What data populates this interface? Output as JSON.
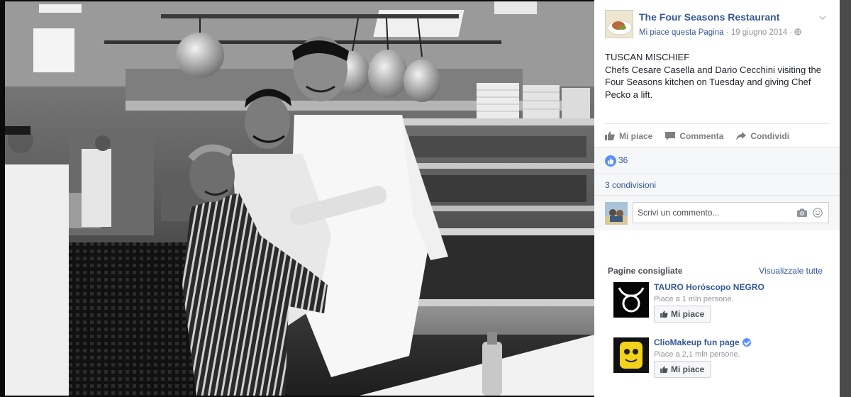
{
  "post": {
    "page_name": "The Four Seasons Restaurant",
    "like_page_link": "Mi piace questa Pagina",
    "separator": "·",
    "date": "19 giugno 2014",
    "separator2": "·",
    "caption_title": "TUSCAN MISCHIEF",
    "caption_body": "Chefs Cesare Casella and Dario Cecchini visiting the Four Seasons kitchen on Tuesday and giving Chef Pecko a lift."
  },
  "actions": {
    "like": "Mi piace",
    "comment": "Commenta",
    "share": "Condividi"
  },
  "reactions": {
    "count": "36"
  },
  "shares": {
    "text": "3 condivisioni"
  },
  "comment": {
    "placeholder": "Scrivi un commento..."
  },
  "recommended": {
    "title": "Pagine consigliate",
    "see_all": "Visualizzale tutte",
    "items": [
      {
        "name": "TAURO Horóscopo NEGRO",
        "likes": "Piace a 1 mln persone.",
        "button": "Mi piace",
        "verified": false
      },
      {
        "name": "ClioMakeup fun page",
        "likes": "Piace a 2,1 mln persone.",
        "button": "Mi piace",
        "verified": true
      }
    ]
  },
  "colors": {
    "link": "#365899",
    "like_blue": "#5890ff",
    "muted": "#90949c"
  },
  "icons": [
    "chevron-down-icon",
    "globe-icon",
    "thumbs-up-icon",
    "comment-icon",
    "share-icon",
    "camera-icon",
    "smiley-icon",
    "verified-icon"
  ]
}
